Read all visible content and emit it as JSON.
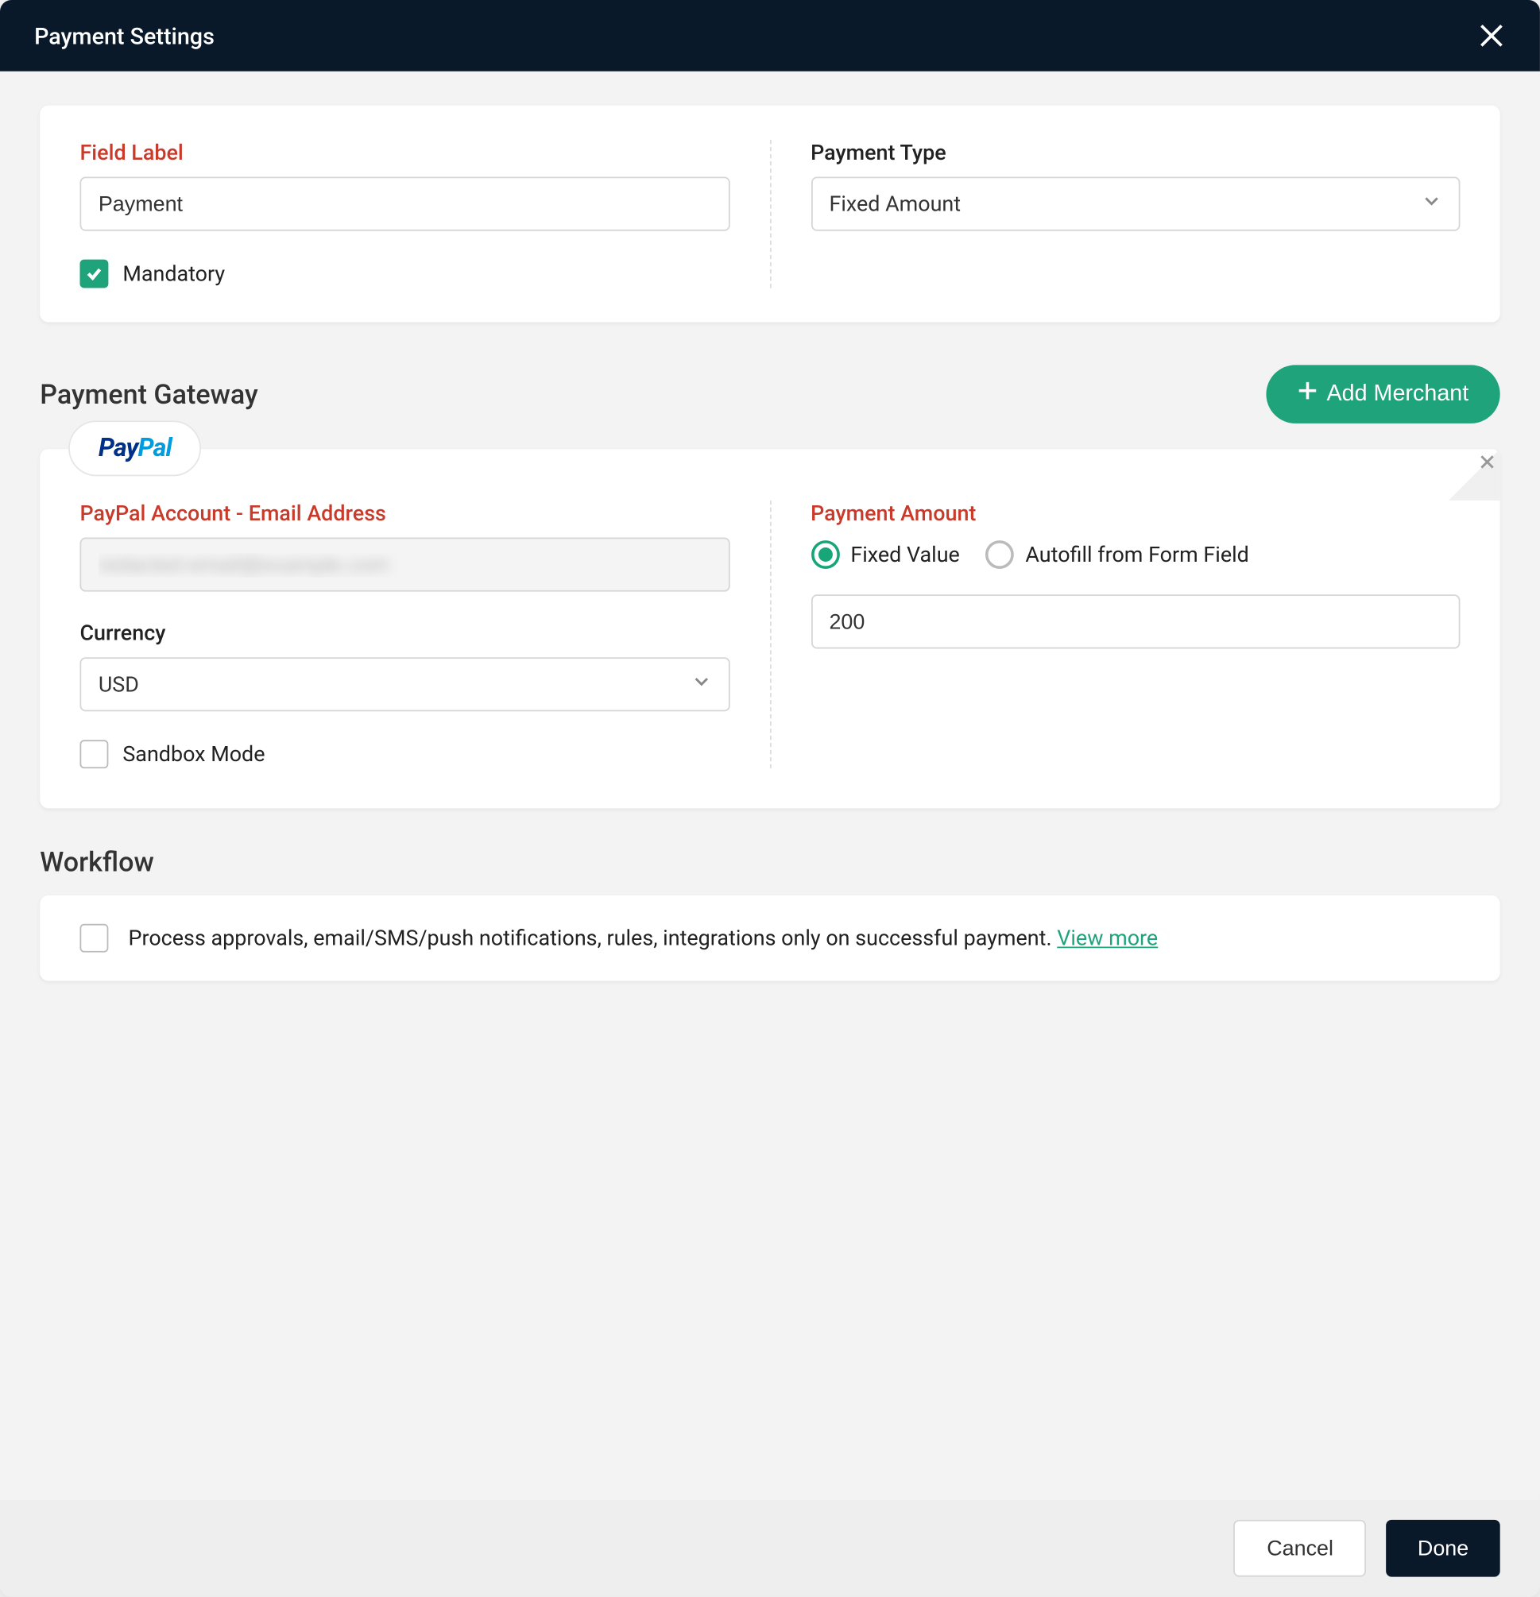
{
  "header": {
    "title": "Payment Settings"
  },
  "fieldCard": {
    "fieldLabelLabel": "Field Label",
    "fieldLabelValue": "Payment",
    "mandatoryLabel": "Mandatory",
    "mandatoryChecked": true,
    "paymentTypeLabel": "Payment Type",
    "paymentTypeValue": "Fixed Amount"
  },
  "gateway": {
    "sectionTitle": "Payment Gateway",
    "addMerchantLabel": "Add Merchant",
    "providerName": "PayPal",
    "accountLabel": "PayPal Account - Email Address",
    "accountValue": "redacted-email@example.com",
    "currencyLabel": "Currency",
    "currencyValue": "USD",
    "sandboxLabel": "Sandbox Mode",
    "sandboxChecked": false,
    "paymentAmountLabel": "Payment Amount",
    "fixedValueLabel": "Fixed Value",
    "autofillLabel": "Autofill from Form Field",
    "amountValue": "200"
  },
  "workflow": {
    "sectionTitle": "Workflow",
    "text": "Process approvals, email/SMS/push notifications, rules, integrations only on successful payment. ",
    "viewMore": "View more",
    "checked": false
  },
  "footer": {
    "cancel": "Cancel",
    "done": "Done"
  }
}
